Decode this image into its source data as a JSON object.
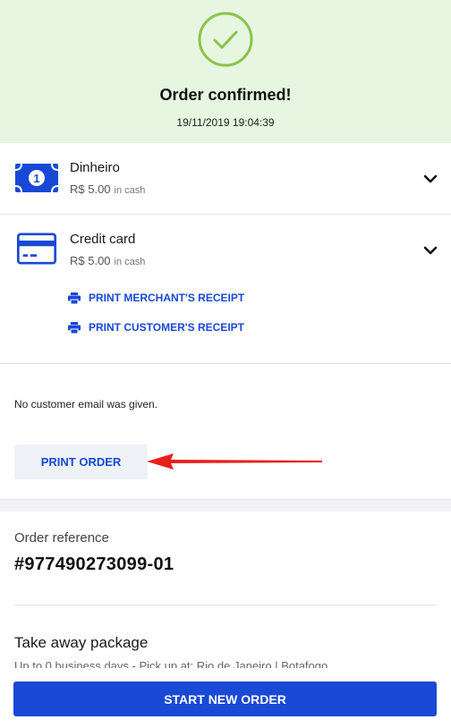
{
  "header": {
    "title": "Order confirmed!",
    "datetime": "19/11/2019 19:04:39",
    "background": "#e6f6e0",
    "check_color": "#8bc34a"
  },
  "payments": [
    {
      "name": "Dinheiro",
      "amount": "R$ 5.00",
      "unit": "in cash",
      "icon": "banknote-icon"
    },
    {
      "name": "Credit card",
      "amount": "R$ 5.00",
      "unit": "in cash",
      "icon": "credit-card-icon"
    }
  ],
  "receipts": {
    "merchant": "PRINT MERCHANT'S RECEIPT",
    "customer": "PRINT CUSTOMER'S RECEIPT"
  },
  "email_note": "No customer email was given.",
  "print_order_label": "PRINT ORDER",
  "order": {
    "reference_label": "Order reference",
    "reference_value": "#977490273099-01"
  },
  "package": {
    "title": "Take away package",
    "subtitle": "Up to 0 business days - Pick up at: Rio de Janeiro | Botafogo"
  },
  "start_button_label": "START NEW ORDER",
  "colors": {
    "accent": "#1849d6",
    "annotation_arrow": "#e8201a"
  }
}
